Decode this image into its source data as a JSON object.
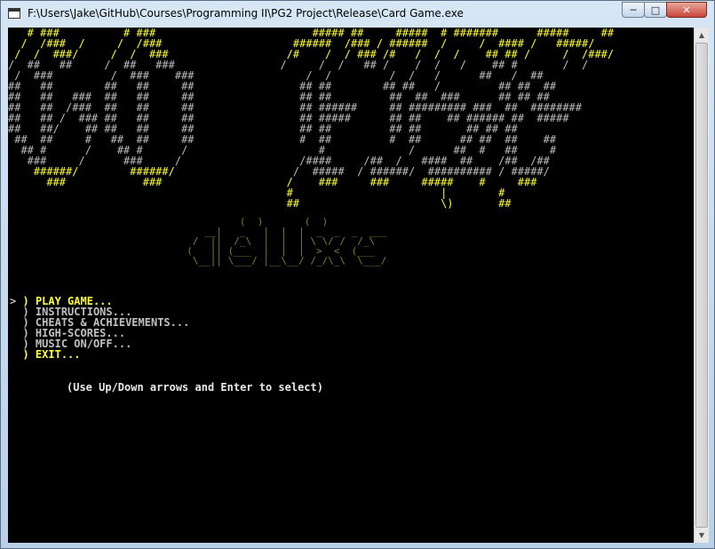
{
  "window": {
    "title": "F:\\Users\\Jake\\GitHub\\Courses\\Programming II\\PG2 Project\\Release\\Card Game.exe",
    "minimize_icon": "minimize-icon",
    "maximize_icon": "maximize-icon",
    "close_icon": "close-icon"
  },
  "colors": {
    "console_bg": "#000000",
    "highlight": "#ffff33",
    "normal_text": "#c0c0c0",
    "deluxe": "#8a7b2a"
  },
  "banner": {
    "go_art": "   # ###          # ###\n  /  /###  /     /  /###\n /  /  ###/     /  /  ###\n/  ##   ##     /  ##   ###\n /  ###         /  ###    ###\n##   ##        ##   ##     ##\n##   ##   ###  ##   ##     ##\n##   ##  /###  ##   ##     ##\n##   ## /  ### ##   ##     ##\n##   ##/    ## ##   ##     ##\n ##  ##     #   ##  ##     ##\n  ## #      /    ## #      /\n   ###     /      ###     /\n    ######/        ######/\n      ###            ###",
    "fish_art": "       ##### ##     #####  # #######      #####     ##\n    ######  /### / ######  /     /  #### /   #####/\n   /#    /  / ### /#   /  /  /    ## ## /     /  /###/\n  /     /  /   ## /    /  /   /    ## #       /  /\n      /  /         /  /   /      ##   /  ##\n     ## ##        ## ##   /         ## ##  ##\n     ## ##         ##  ##  ###      ## ## ##\n     ## ######     ## ######### ###  ##  ########\n     ## #####      ## ##    ## ###### ##  #####\n     ## ##         ## ##       ## ## ##\n     #  ##         #  ##      ## ##  ##    ##\n        #             /      ##  #   ##     #\n     /####     /##  /   ####  ##    /##  /##\n    /  #####  / ######/  ########## / #####/\n   /    ###     ###     #####    #     ###\n   #                       |        #\n   ##                      \\)       ##",
    "deluxe_art": "           (  )       (  )\n     __|   _   |  |  |  _  _  _  ___\n   /  ||  /_\\  |  |  | \\ \\/ /  /_\\\n  (   || (___  |  |  |  >  <  (___\n   \\__|| \\___/ |__\\__/ /_/\\_\\  \\___/"
  },
  "menu": {
    "items": [
      {
        "label": "PLAY GAME...",
        "selected": true,
        "color": "#ffff33"
      },
      {
        "label": "INSTRUCTIONS...",
        "selected": false,
        "color": "#c0c0c0"
      },
      {
        "label": "CHEATS & ACHIEVEMENTS...",
        "selected": false,
        "color": "#c0c0c0"
      },
      {
        "label": "HIGH-SCORES...",
        "selected": false,
        "color": "#c0c0c0"
      },
      {
        "label": "MUSIC ON/OFF...",
        "selected": false,
        "color": "#c0c0c0"
      },
      {
        "label": "EXIT...",
        "selected": false,
        "color": "#ffff33"
      }
    ],
    "cursor": ">",
    "bullet": ")"
  },
  "hint": "(Use Up/Down arrows and Enter to select)"
}
